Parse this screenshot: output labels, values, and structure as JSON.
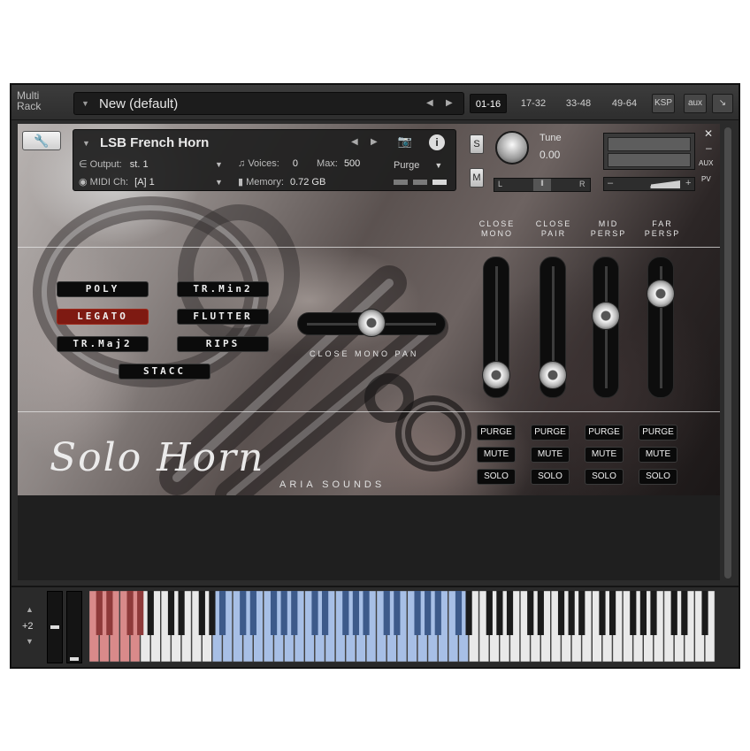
{
  "rack": {
    "label": "Multi Rack",
    "preset_name": "New (default)",
    "tabs": [
      "01-16",
      "17-32",
      "33-48",
      "49-64"
    ],
    "active_tab": "01-16",
    "ksp_label": "KSP",
    "aux_label": "aux"
  },
  "instrument": {
    "name": "LSB French Horn",
    "output_label": "Output:",
    "output_value": "st. 1",
    "voices_label": "Voices:",
    "voices_value": "0",
    "max_label": "Max:",
    "max_value": "500",
    "purge_label": "Purge",
    "midi_label": "MIDI Ch:",
    "midi_value": "[A]  1",
    "memory_label": "Memory:",
    "memory_value": "0.72 GB",
    "solo_label": "S",
    "mute_label": "M",
    "tune_label": "Tune",
    "tune_value": "0.00",
    "pan_left": "L",
    "pan_right": "R",
    "aux_mini": "AUX",
    "pv_mini": "PV"
  },
  "articulations": [
    {
      "label": "POLY",
      "active": false
    },
    {
      "label": "TR.Min2",
      "active": false
    },
    {
      "label": "LEGATO",
      "active": true
    },
    {
      "label": "FLUTTER",
      "active": false
    },
    {
      "label": "TR.Maj2",
      "active": false
    },
    {
      "label": "RIPS",
      "active": false
    },
    {
      "label": "STACC",
      "active": false
    }
  ],
  "mics": [
    {
      "line1": "CLOSE",
      "line2": "MONO",
      "level": 0.08
    },
    {
      "line1": "CLOSE",
      "line2": "PAIR",
      "level": 0.08
    },
    {
      "line1": "MID",
      "line2": "PERSP",
      "level": 0.6
    },
    {
      "line1": "FAR",
      "line2": "PERSP",
      "level": 0.8
    }
  ],
  "mic_buttons": {
    "purge": "PURGE",
    "mute": "MUTE",
    "solo": "SOLO"
  },
  "pan": {
    "label": "CLOSE MONO PAN",
    "value": 0.5
  },
  "logo": {
    "script": "Solo Horn",
    "brand": "ARIA SOUNDS"
  },
  "keyboard": {
    "octave": "+2"
  },
  "colors": {
    "legato_active": "#7e1a12",
    "key_red": "#d98a8a",
    "key_blue": "#a7bfe6"
  }
}
